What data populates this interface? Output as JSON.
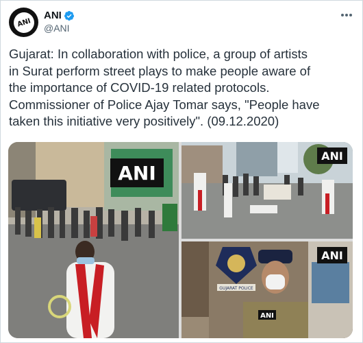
{
  "account": {
    "display_name": "ANI",
    "handle": "@ANI",
    "avatar_label": "ANI",
    "verified_color": "#1d9bf0"
  },
  "tweet": {
    "text": "Gujarat: In collaboration with police, a group of artists\nin Surat perform street plays to make people aware of\nthe importance of COVID-19 related protocols.\nCommissioner of Police Ajay Tomar says, \"People have\ntaken this initiative very positively\". (09.12.2020)"
  },
  "media": {
    "watermark": "ANI",
    "mic_flag": "ANI",
    "badge_text": "GUJARAT POLICE"
  },
  "icons": {
    "more": "more-options-icon",
    "verified": "verified-badge-icon"
  }
}
